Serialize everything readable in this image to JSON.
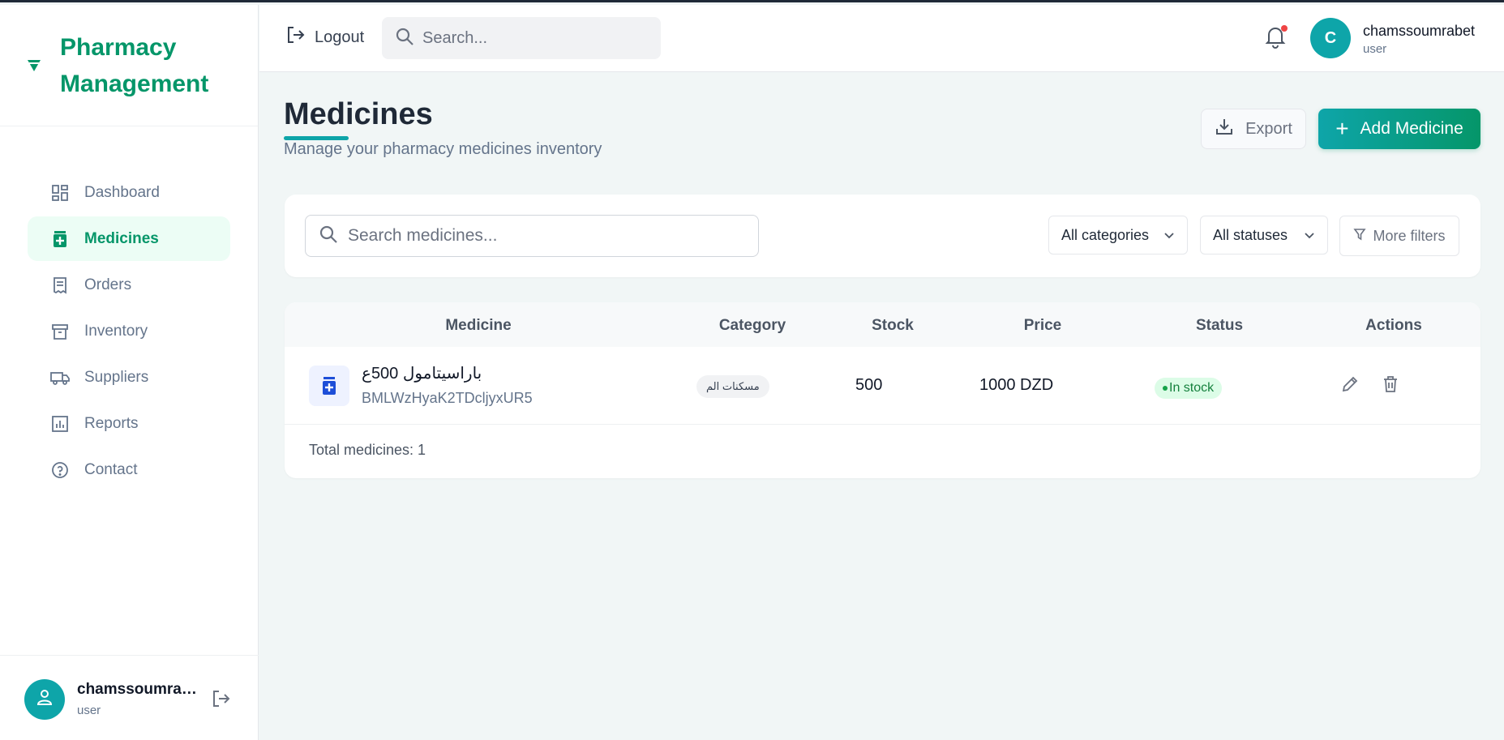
{
  "brand": {
    "title": "Pharmacy Management",
    "accent": "#059669"
  },
  "sidebar": {
    "items": [
      {
        "label": "Dashboard",
        "icon": "dashboard-icon"
      },
      {
        "label": "Medicines",
        "icon": "medicine-icon",
        "active": true
      },
      {
        "label": "Orders",
        "icon": "receipt-icon"
      },
      {
        "label": "Inventory",
        "icon": "archive-icon"
      },
      {
        "label": "Suppliers",
        "icon": "truck-icon"
      },
      {
        "label": "Reports",
        "icon": "bar-chart-icon"
      },
      {
        "label": "Contact",
        "icon": "help-circle-icon"
      }
    ],
    "user": {
      "name": "chamssoumrabet",
      "role": "user"
    }
  },
  "topbar": {
    "logout_label": "Logout",
    "search_placeholder": "Search...",
    "user": {
      "initial": "C",
      "name": "chamssoumrabet",
      "role": "user"
    }
  },
  "header": {
    "title": "Medicines",
    "subtitle": "Manage your pharmacy medicines inventory",
    "export_label": "Export",
    "add_label": "Add Medicine"
  },
  "filters": {
    "search_placeholder": "Search medicines...",
    "category_selected": "All categories",
    "status_selected": "All statuses",
    "more_label": "More filters"
  },
  "table": {
    "columns": [
      "Medicine",
      "Category",
      "Stock",
      "Price",
      "Status",
      "Actions"
    ],
    "rows": [
      {
        "name": "باراسيتامول 500ع",
        "code": "BMLWzHyaK2TDcljyxUR5",
        "category": "مسكنات الم",
        "stock": "500",
        "price": "1000 DZD",
        "status": "In stock"
      }
    ],
    "footer": "Total medicines: 1"
  }
}
